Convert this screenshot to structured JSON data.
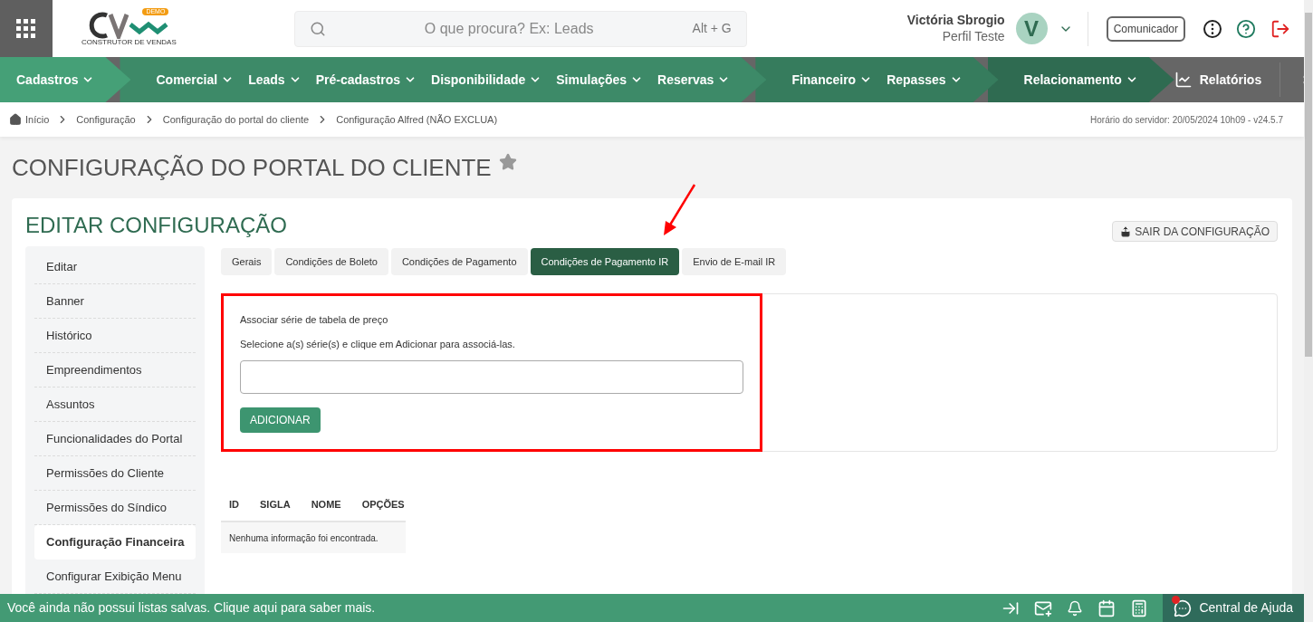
{
  "header": {
    "search": {
      "placeholder": "O que procura? Ex: Leads",
      "shortcut": "Alt + G"
    },
    "logo": {
      "badge": "DEMO",
      "tagline": "CONSTRUTOR DE VENDAS"
    },
    "user": {
      "name": "Victória Sbrogio",
      "profile": "Perfil Teste",
      "initial": "V"
    },
    "communicator": "Comunicador"
  },
  "nav": {
    "groups": [
      {
        "color": "#45a077",
        "items": [
          "Cadastros"
        ]
      },
      {
        "color": "#3d8a68",
        "items": [
          "Comercial",
          "Leads",
          "Pré-cadastros",
          "Disponibilidade",
          "Simulações",
          "Reservas"
        ]
      },
      {
        "color": "#367c5d",
        "items": [
          "Financeiro",
          "Repasses"
        ]
      },
      {
        "color": "#2f6b51",
        "items": [
          "Relacionamento"
        ]
      }
    ],
    "reports": "Relatórios"
  },
  "breadcrumb": [
    "Início",
    "Configuração",
    "Configuração do portal do cliente",
    "Configuração Alfred (NÃO EXCLUA)"
  ],
  "server_time": "Horário do servidor: 20/05/2024 10h09 - v24.5.7",
  "page_title": "CONFIGURAÇÃO DO PORTAL DO CLIENTE",
  "card": {
    "title": "EDITAR CONFIGURAÇÃO",
    "exit_button": "SAIR DA CONFIGURAÇÃO",
    "sidebar": [
      {
        "label": "Editar",
        "selected": false
      },
      {
        "label": "Banner",
        "selected": false
      },
      {
        "label": "Histórico",
        "selected": false
      },
      {
        "label": "Empreendimentos",
        "selected": false
      },
      {
        "label": "Assuntos",
        "selected": false
      },
      {
        "label": "Funcionalidades do Portal",
        "selected": false
      },
      {
        "label": "Permissões do Cliente",
        "selected": false
      },
      {
        "label": "Permissões do Síndico",
        "selected": false
      },
      {
        "label": "Configuração Financeira",
        "selected": true
      },
      {
        "label": "Configurar Exibição Menu",
        "selected": false
      }
    ],
    "tabs": [
      {
        "label": "Gerais",
        "selected": false
      },
      {
        "label": "Condições de Boleto",
        "selected": false
      },
      {
        "label": "Condições de Pagamento",
        "selected": false
      },
      {
        "label": "Condições de Pagamento IR",
        "selected": true
      },
      {
        "label": "Envio de E-mail IR",
        "selected": false
      }
    ],
    "form": {
      "heading": "Associar série de tabela de preço",
      "hint": "Selecione a(s) série(s) e clique em Adicionar para associá-las.",
      "button": "ADICIONAR"
    },
    "table": {
      "columns": [
        "ID",
        "SIGLA",
        "NOME",
        "OPÇÕES"
      ],
      "empty_message": "Nenhuma informação foi encontrada."
    }
  },
  "status_bar": {
    "message": "Você ainda não possui listas salvas. Clique aqui para saber mais.",
    "help": "Central de Ajuda"
  }
}
